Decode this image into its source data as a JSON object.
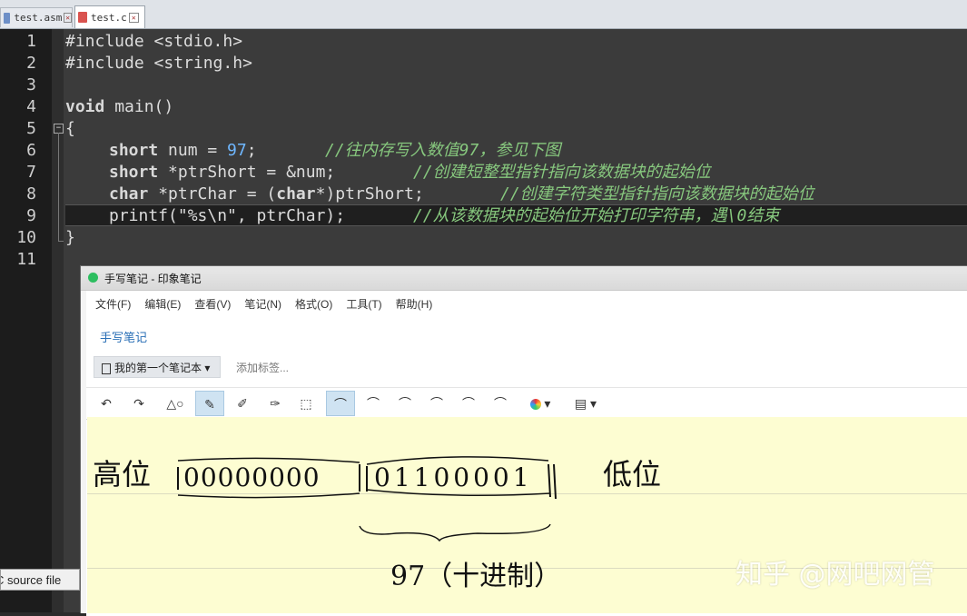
{
  "tabs": [
    {
      "label": "test.asm",
      "icon": "asm-file-icon",
      "active": false
    },
    {
      "label": "test.c",
      "icon": "c-file-icon",
      "active": true
    }
  ],
  "editor": {
    "line_numbers": [
      "1",
      "2",
      "3",
      "4",
      "5",
      "6",
      "7",
      "8",
      "9",
      "10",
      "11"
    ],
    "lines": {
      "l1": "#include <stdio.h>",
      "l2": "#include <string.h>",
      "l4a": "void",
      "l4b": " main()",
      "l5": "{",
      "l6a": "short",
      "l6b": " num = ",
      "l6c": "97",
      "l6d": ";",
      "l6e": "//往内存写入数值97，参见下图",
      "l7a": "short",
      "l7b": " *ptrShort = &num;",
      "l7c": "//创建短整型指针指向该数据块的起始位",
      "l8a": "char",
      "l8b": " *ptrChar = (",
      "l8c": "char",
      "l8d": "*)ptrShort;",
      "l8e": "//创建字符类型指针指向该数据块的起始位",
      "l9a": "printf(\"%s\\n\", ptrChar);",
      "l9b": "//从该数据块的起始位开始打印字符串，遇\\0结束",
      "l10": "}"
    },
    "fold_marker": "⊟",
    "status_text": "C source file"
  },
  "evernote": {
    "title": "手写笔记 - 印象笔记",
    "menu": [
      "文件(F)",
      "编辑(E)",
      "查看(V)",
      "笔记(N)",
      "格式(O)",
      "工具(T)",
      "帮助(H)"
    ],
    "note_title": "手写笔记",
    "notebook": "我的第一个笔记本 ▾",
    "tag_placeholder": "添加标签...",
    "toolbar_icons": [
      "undo-icon",
      "redo-icon",
      "shapes-icon",
      "pen-icon",
      "marker-icon",
      "highlighter-icon",
      "select-icon",
      "stroke-1-icon",
      "stroke-2-icon",
      "stroke-3-icon",
      "stroke-4-icon",
      "stroke-5-icon",
      "stroke-6-icon",
      "color-picker-icon",
      "page-style-icon"
    ]
  },
  "handwriting": {
    "left_label": "高位",
    "high_byte": "00000000",
    "low_byte": "01100001",
    "right_label": "低位",
    "caption": "97（十进制）"
  },
  "watermark": "知乎 @网吧网管",
  "colors": {
    "accent": "#2dbe60",
    "note_bg": "#fdfdd2",
    "editor_bg": "#3b3b3b"
  }
}
